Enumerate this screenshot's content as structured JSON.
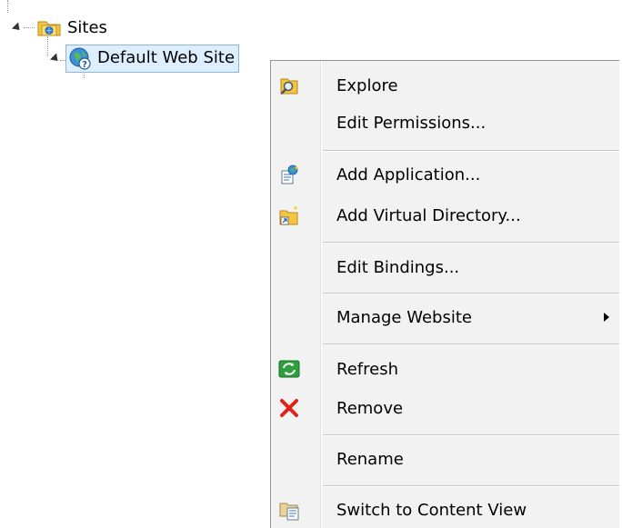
{
  "tree": {
    "root_label": "Sites",
    "child_label": "Default Web Site"
  },
  "menu": {
    "items": [
      {
        "label": "Explore",
        "icon": "explore-icon"
      },
      {
        "label": "Edit Permissions...",
        "icon": ""
      },
      {
        "label": "Add Application...",
        "icon": "add-application-icon"
      },
      {
        "label": "Add Virtual Directory...",
        "icon": "add-virtual-directory-icon"
      },
      {
        "label": "Edit Bindings...",
        "icon": ""
      },
      {
        "label": "Manage Website",
        "icon": "",
        "submenu": true
      },
      {
        "label": "Refresh",
        "icon": "refresh-icon"
      },
      {
        "label": "Remove",
        "icon": "remove-icon"
      },
      {
        "label": "Rename",
        "icon": ""
      },
      {
        "label": "Switch to Content View",
        "icon": "content-view-icon"
      }
    ]
  },
  "colors": {
    "menu_bg": "#f2f2f2",
    "selection_bg": "#ddeeff",
    "selection_border": "#8ab6e6",
    "remove_red": "#e0201a",
    "refresh_green": "#2e9e3e"
  }
}
